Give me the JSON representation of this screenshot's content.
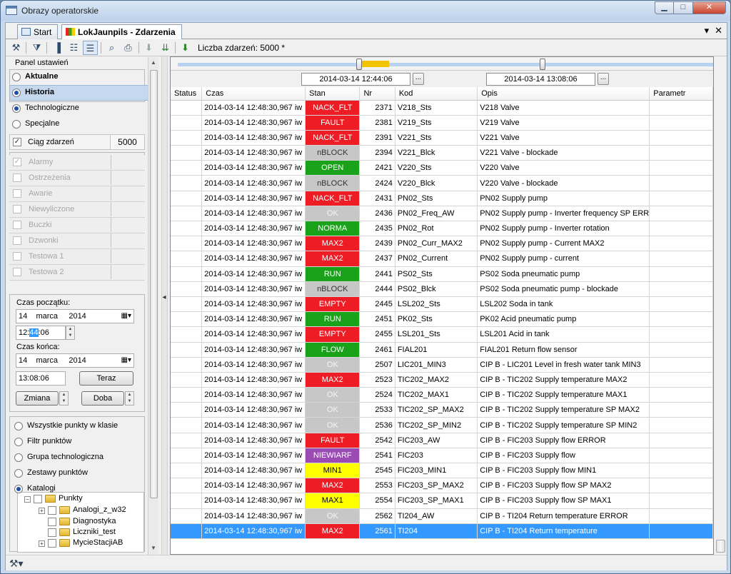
{
  "window": {
    "title": "Obrazy operatorskie"
  },
  "tabs": [
    {
      "label": "Start"
    },
    {
      "label": "LokJaunpils - Zdarzenia"
    }
  ],
  "toolbar": {
    "count_label": "Liczba zdarzeń: 5000 *"
  },
  "panel": {
    "title": "Panel ustawień",
    "mode_current": "Aktualne",
    "mode_history": "Historia",
    "type_tech": "Technologiczne",
    "type_special": "Specjalne",
    "sequence_label": "Ciąg zdarzeń",
    "sequence_value": "5000",
    "filters": [
      "Alarmy",
      "Ostrzeżenia",
      "Awarie",
      "Niewyliczone",
      "Buczki",
      "Dzwonki",
      "Testowa 1",
      "Testowa 2"
    ],
    "start_label": "Czas początku:",
    "start_day": "14",
    "start_month": "marca",
    "start_year": "2014",
    "start_h": "12:",
    "start_m": "44",
    "start_s": ":06",
    "end_label": "Czas końca:",
    "end_day": "14",
    "end_month": "marca",
    "end_year": "2014",
    "end_time": "13:08:06",
    "now_button": "Teraz",
    "change_label": "Zmiana",
    "day_label": "Doba",
    "scope": [
      "Wszystkie punkty w klasie",
      "Filtr punktów",
      "Grupa technologiczna",
      "Zestawy punktów",
      "Katalogi"
    ],
    "tree": [
      "Punkty",
      "Analogi_z_w32",
      "Diagnostyka",
      "Liczniki_test",
      "MycieStacjiAB"
    ]
  },
  "range": {
    "from": "2014-03-14 12:44:06",
    "to": "2014-03-14 13:08:06",
    "ellipsis": "..."
  },
  "columns": [
    "Status",
    "Czas",
    "Stan",
    "Nr",
    "Kod",
    "Opis",
    "Parametr"
  ],
  "colors": {
    "red": "#ee1c24",
    "green": "#1aa31a",
    "grey": "#c7c7c7",
    "purple": "#9b4cb4",
    "yellow": "#ffff00",
    "selected": "#3399ff"
  },
  "rows": [
    {
      "time": "2014-03-14 12:48:30,967 iw",
      "state": "NACK_FLT",
      "c": "red",
      "nr": "2371",
      "kod": "V218_Sts",
      "opis": "V218 Valve"
    },
    {
      "time": "2014-03-14 12:48:30,967 iw",
      "state": "FAULT",
      "c": "red",
      "nr": "2381",
      "kod": "V219_Sts",
      "opis": "V219 Valve"
    },
    {
      "time": "2014-03-14 12:48:30,967 iw",
      "state": "NACK_FLT",
      "c": "red",
      "nr": "2391",
      "kod": "V221_Sts",
      "opis": "V221 Valve"
    },
    {
      "time": "2014-03-14 12:48:30,967 iw",
      "state": "nBLOCK",
      "c": "grey",
      "nr": "2394",
      "kod": "V221_Blck",
      "opis": "V221 Valve - blockade"
    },
    {
      "time": "2014-03-14 12:48:30,967 iw",
      "state": "OPEN",
      "c": "green",
      "nr": "2421",
      "kod": "V220_Sts",
      "opis": "V220 Valve"
    },
    {
      "time": "2014-03-14 12:48:30,967 iw",
      "state": "nBLOCK",
      "c": "grey",
      "nr": "2424",
      "kod": "V220_Blck",
      "opis": "V220 Valve - blockade"
    },
    {
      "time": "2014-03-14 12:48:30,967 iw",
      "state": "NACK_FLT",
      "c": "red",
      "nr": "2431",
      "kod": "PN02_Sts",
      "opis": "PN02 Supply pump"
    },
    {
      "time": "2014-03-14 12:48:30,967 iw",
      "state": "OK",
      "c": "greyok",
      "nr": "2436",
      "kod": "PN02_Freq_AW",
      "opis": "PN02 Supply pump - Inverter frequency SP ERR"
    },
    {
      "time": "2014-03-14 12:48:30,967 iw",
      "state": "NORMA",
      "c": "green",
      "nr": "2435",
      "kod": "PN02_Rot",
      "opis": "PN02 Supply pump - Inverter rotation"
    },
    {
      "time": "2014-03-14 12:48:30,967 iw",
      "state": "MAX2",
      "c": "red",
      "nr": "2439",
      "kod": "PN02_Curr_MAX2",
      "opis": "PN02 Supply pump - Current MAX2"
    },
    {
      "time": "2014-03-14 12:48:30,967 iw",
      "state": "MAX2",
      "c": "red",
      "nr": "2437",
      "kod": "PN02_Current",
      "opis": "PN02 Supply pump - current"
    },
    {
      "time": "2014-03-14 12:48:30,967 iw",
      "state": "RUN",
      "c": "green",
      "nr": "2441",
      "kod": "PS02_Sts",
      "opis": "PS02 Soda pneumatic pump"
    },
    {
      "time": "2014-03-14 12:48:30,967 iw",
      "state": "nBLOCK",
      "c": "grey",
      "nr": "2444",
      "kod": "PS02_Blck",
      "opis": "PS02 Soda pneumatic pump - blockade"
    },
    {
      "time": "2014-03-14 12:48:30,967 iw",
      "state": "EMPTY",
      "c": "red",
      "nr": "2445",
      "kod": "LSL202_Sts",
      "opis": "LSL202 Soda in tank"
    },
    {
      "time": "2014-03-14 12:48:30,967 iw",
      "state": "RUN",
      "c": "green",
      "nr": "2451",
      "kod": "PK02_Sts",
      "opis": "PK02 Acid pneumatic pump"
    },
    {
      "time": "2014-03-14 12:48:30,967 iw",
      "state": "EMPTY",
      "c": "red",
      "nr": "2455",
      "kod": "LSL201_Sts",
      "opis": "LSL201 Acid in tank"
    },
    {
      "time": "2014-03-14 12:48:30,967 iw",
      "state": "FLOW",
      "c": "green",
      "nr": "2461",
      "kod": "FIAL201",
      "opis": "FIAL201 Return flow sensor"
    },
    {
      "time": "2014-03-14 12:48:30,967 iw",
      "state": "OK",
      "c": "greyok",
      "nr": "2507",
      "kod": "LIC201_MIN3",
      "opis": "CIP B - LIC201 Level in fresh water tank MIN3"
    },
    {
      "time": "2014-03-14 12:48:30,967 iw",
      "state": "MAX2",
      "c": "red",
      "nr": "2523",
      "kod": "TIC202_MAX2",
      "opis": "CIP B - TIC202 Supply temperature MAX2"
    },
    {
      "time": "2014-03-14 12:48:30,967 iw",
      "state": "OK",
      "c": "greyok",
      "nr": "2524",
      "kod": "TIC202_MAX1",
      "opis": "CIP B - TIC202 Supply temperature MAX1"
    },
    {
      "time": "2014-03-14 12:48:30,967 iw",
      "state": "OK",
      "c": "greyok",
      "nr": "2533",
      "kod": "TIC202_SP_MAX2",
      "opis": "CIP B - TIC202 Supply temperature SP MAX2"
    },
    {
      "time": "2014-03-14 12:48:30,967 iw",
      "state": "OK",
      "c": "greyok",
      "nr": "2536",
      "kod": "TIC202_SP_MIN2",
      "opis": "CIP B - TIC202 Supply temperature SP MIN2"
    },
    {
      "time": "2014-03-14 12:48:30,967 iw",
      "state": "FAULT",
      "c": "red",
      "nr": "2542",
      "kod": "FIC203_AW",
      "opis": "CIP B - FIC203 Supply flow ERROR"
    },
    {
      "time": "2014-03-14 12:48:30,967 iw",
      "state": "NIEWIARF",
      "c": "purple",
      "nr": "2541",
      "kod": "FIC203",
      "opis": "CIP B - FIC203 Supply flow"
    },
    {
      "time": "2014-03-14 12:48:30,967 iw",
      "state": "MIN1",
      "c": "yellow",
      "nr": "2545",
      "kod": "FIC203_MIN1",
      "opis": "CIP B - FIC203 Supply flow MIN1"
    },
    {
      "time": "2014-03-14 12:48:30,967 iw",
      "state": "MAX2",
      "c": "red",
      "nr": "2553",
      "kod": "FIC203_SP_MAX2",
      "opis": "CIP B - FIC203 Supply flow SP MAX2"
    },
    {
      "time": "2014-03-14 12:48:30,967 iw",
      "state": "MAX1",
      "c": "yellow",
      "nr": "2554",
      "kod": "FIC203_SP_MAX1",
      "opis": "CIP B - FIC203 Supply flow SP MAX1"
    },
    {
      "time": "2014-03-14 12:48:30,967 iw",
      "state": "OK",
      "c": "greyok",
      "nr": "2562",
      "kod": "TI204_AW",
      "opis": "CIP B - TI204 Return temperature ERROR"
    },
    {
      "time": "2014-03-14 12:48:30,967 iw",
      "state": "MAX2",
      "c": "red",
      "nr": "2561",
      "kod": "TI204",
      "opis": "CIP B - TI204 Return temperature",
      "selected": true
    }
  ]
}
